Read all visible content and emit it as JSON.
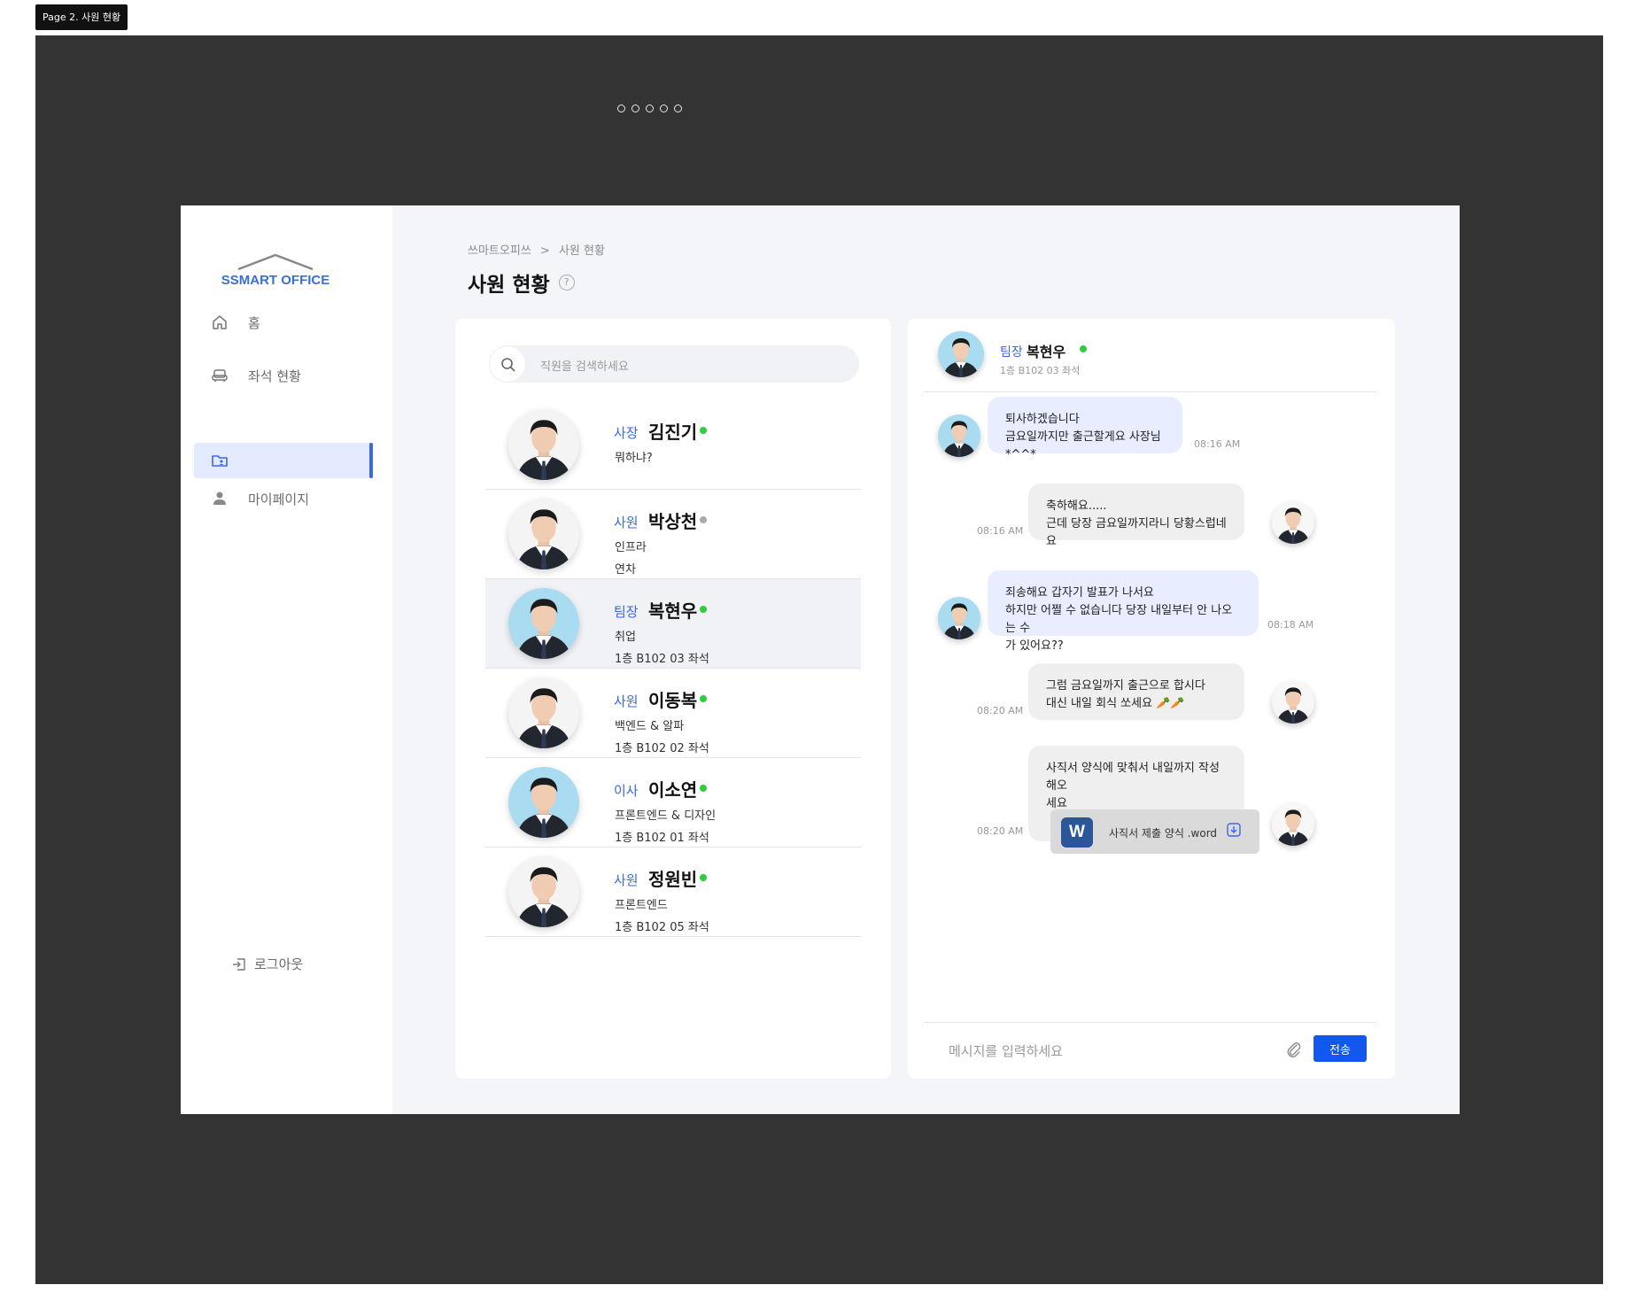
{
  "page_tag": "Page 2. 사원 현황",
  "sidebar": {
    "logo_text": "SSMART OFFICE",
    "items": [
      {
        "label": "홈",
        "icon": "home-icon"
      },
      {
        "label": "좌석 현황",
        "icon": "seat-icon"
      },
      {
        "label": "",
        "icon": "employee-folder-icon",
        "active": true
      },
      {
        "label": "마이페이지",
        "icon": "user-icon"
      }
    ],
    "logout_label": "로그아웃"
  },
  "header": {
    "breadcrumb_root": "쓰마트오피쓰",
    "breadcrumb_sep": ">",
    "breadcrumb_current": "사원 현황",
    "title": "사원 현황",
    "help": "?"
  },
  "search": {
    "placeholder": "직원을 검색하세요"
  },
  "employees": [
    {
      "rank": "사장",
      "name": "김진기",
      "status": "online",
      "line1": "뭐하냐?",
      "line2": ""
    },
    {
      "rank": "사원",
      "name": "박상천",
      "status": "offline",
      "line1": "인프라",
      "line2": "연차"
    },
    {
      "rank": "팀장",
      "name": "복현우",
      "status": "online",
      "line1": "취업",
      "line2": "1층 B102 03 좌석"
    },
    {
      "rank": "사원",
      "name": "이동복",
      "status": "online",
      "line1": "백엔드 & 알파",
      "line2": "1층 B102 02 좌석"
    },
    {
      "rank": "이사",
      "name": "이소연",
      "status": "online",
      "line1": "프론트엔드 & 디자인",
      "line2": "1층 B102 01 좌석"
    },
    {
      "rank": "사원",
      "name": "정원빈",
      "status": "online",
      "line1": "프론트엔드",
      "line2": "1층 B102 05 좌석"
    }
  ],
  "colors": {
    "online": "#2ecc40",
    "offline": "#aaaaaa",
    "accent": "#3b67e8",
    "send": "#1258f0"
  },
  "chat": {
    "rank": "팀장",
    "name": "복현우",
    "seat": "1층 B102 03 좌석",
    "messages": [
      {
        "dir": "in",
        "lines": [
          "퇴사하겠습니다",
          "금요일까지만 출근할게요 사장님 *^^*"
        ],
        "time": "08:16 AM"
      },
      {
        "dir": "out",
        "lines": [
          "축하해요.....",
          "근데 당장 금요일까지라니 당황스럽네요"
        ],
        "time": "08:16 AM"
      },
      {
        "dir": "in",
        "lines": [
          "죄송해요 갑자기 발표가 나서요",
          "하지만 어쩔 수 없습니다 당장 내일부터 안 나오는 수",
          "가 있어요??"
        ],
        "time": "08:18 AM"
      },
      {
        "dir": "out",
        "lines": [
          "그럼 금요일까지 출근으로 합시다",
          "대신 내일 회식 쏘세요 🥕🥕"
        ],
        "time": "08:20 AM"
      },
      {
        "dir": "out",
        "lines": [
          "사직서 양식에 맞춰서 내일까지 작성해오",
          "세요"
        ],
        "time": "08:20 AM",
        "file": {
          "icon_letter": "W",
          "name": "사직서 제출 양식 .word"
        }
      }
    ],
    "input_placeholder": "메시지를 입력하세요",
    "send_label": "전송"
  }
}
